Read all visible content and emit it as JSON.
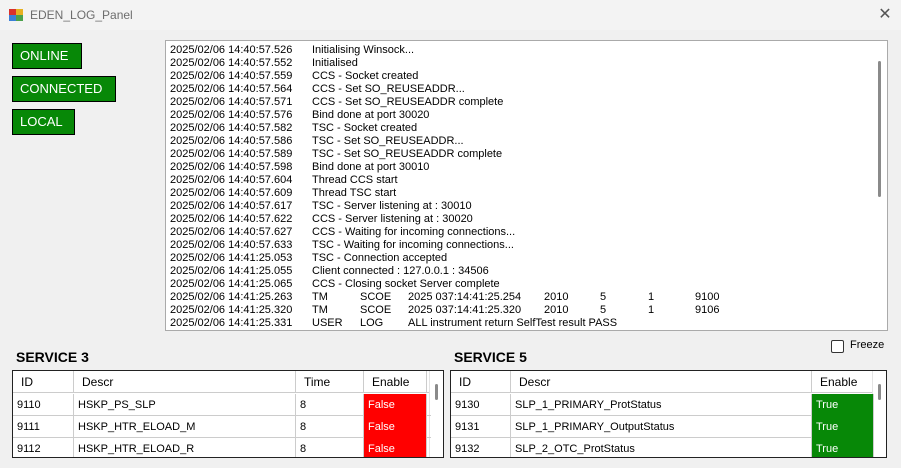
{
  "window": {
    "title": "EDEN_LOG_Panel",
    "close_glyph": "✕"
  },
  "status": {
    "online": "ONLINE",
    "connected": "CONNECTED",
    "local": "LOCAL",
    "color": "#078807"
  },
  "log": {
    "lines": [
      [
        "2025/02/06 14:40:57.526",
        "Initialising Winsock..."
      ],
      [
        "2025/02/06 14:40:57.552",
        "Initialised"
      ],
      [
        "2025/02/06 14:40:57.559",
        "CCS - Socket created"
      ],
      [
        "2025/02/06 14:40:57.564",
        "CCS - Set SO_REUSEADDR..."
      ],
      [
        "2025/02/06 14:40:57.571",
        "CCS - Set SO_REUSEADDR complete"
      ],
      [
        "2025/02/06 14:40:57.576",
        "Bind done at port 30020"
      ],
      [
        "2025/02/06 14:40:57.582",
        "TSC - Socket created"
      ],
      [
        "2025/02/06 14:40:57.586",
        "TSC - Set SO_REUSEADDR..."
      ],
      [
        "2025/02/06 14:40:57.589",
        "TSC - Set SO_REUSEADDR complete"
      ],
      [
        "2025/02/06 14:40:57.598",
        "Bind done at port 30010"
      ],
      [
        "2025/02/06 14:40:57.604",
        "Thread CCS start"
      ],
      [
        "2025/02/06 14:40:57.609",
        "Thread TSC start"
      ],
      [
        "2025/02/06 14:40:57.617",
        "TSC - Server listening at : 30010"
      ],
      [
        "2025/02/06 14:40:57.622",
        "CCS - Server listening at : 30020"
      ],
      [
        "2025/02/06 14:40:57.627",
        "CCS - Waiting for incoming connections..."
      ],
      [
        "2025/02/06 14:40:57.633",
        "TSC - Waiting for incoming connections..."
      ],
      [
        "2025/02/06 14:41:25.053",
        "TSC - Connection accepted"
      ],
      [
        "2025/02/06 14:41:25.055",
        "Client connected : 127.0.0.1 : 34506"
      ],
      [
        "2025/02/06 14:41:25.065",
        "CCS - Closing socket Server complete"
      ]
    ],
    "tm_lines": [
      [
        "2025/02/06 14:41:25.263",
        "TM",
        "SCOE",
        "2025 037:14:41:25.254",
        "2010",
        "5",
        "1",
        "9100"
      ],
      [
        "2025/02/06 14:41:25.320",
        "TM",
        "SCOE",
        "2025 037:14:41:25.320",
        "2010",
        "5",
        "1",
        "9106"
      ],
      [
        "2025/02/06 14:41:25.331",
        "USER",
        "LOG",
        "ALL instrument return SelfTest result PASS",
        "",
        "",
        "",
        ""
      ]
    ]
  },
  "freeze": {
    "label": "Freeze",
    "checked": false
  },
  "service3": {
    "title": "SERVICE 3",
    "columns": [
      "ID",
      "Descr",
      "Time",
      "Enable"
    ],
    "rows": [
      [
        "9110",
        "HSKP_PS_SLP",
        "8",
        "False"
      ],
      [
        "9111",
        "HSKP_HTR_ELOAD_M",
        "8",
        "False"
      ],
      [
        "9112",
        "HSKP_HTR_ELOAD_R",
        "8",
        "False"
      ]
    ],
    "false_color": "#ff0000"
  },
  "service5": {
    "title": "SERVICE 5",
    "columns": [
      "ID",
      "Descr",
      "Enable"
    ],
    "rows": [
      [
        "9130",
        "SLP_1_PRIMARY_ProtStatus",
        "True"
      ],
      [
        "9131",
        "SLP_1_PRIMARY_OutputStatus",
        "True"
      ],
      [
        "9132",
        "SLP_2_OTC_ProtStatus",
        "True"
      ]
    ],
    "true_color": "#078807"
  }
}
